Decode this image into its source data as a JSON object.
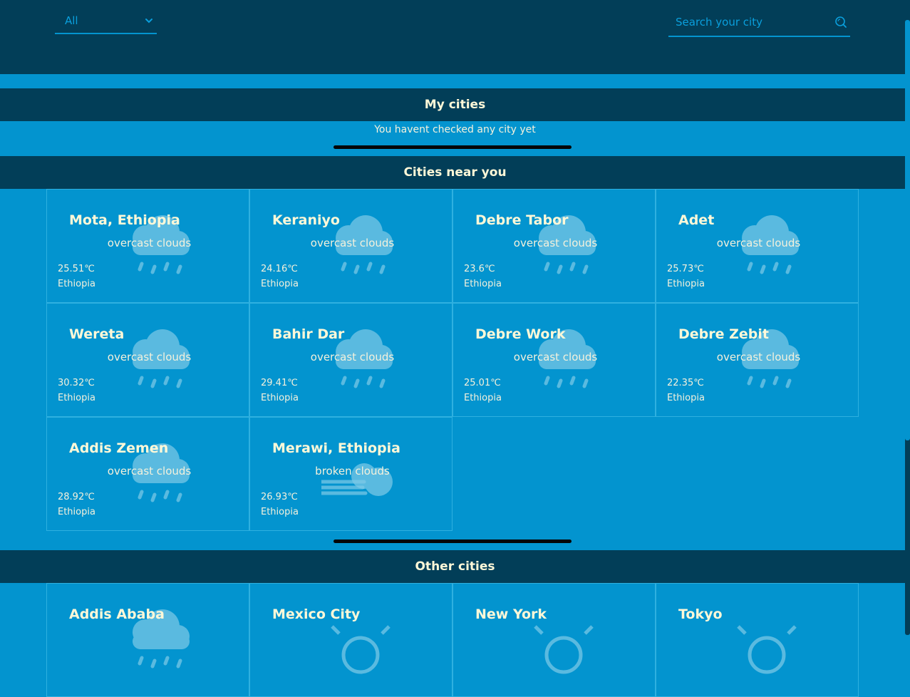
{
  "filter": {
    "value": "All"
  },
  "search": {
    "placeholder": "Search your city"
  },
  "my_cities": {
    "title": "My cities",
    "empty_message": "You havent checked any city yet"
  },
  "near": {
    "title": "Cities near you",
    "cities": [
      {
        "name": "Mota, Ethiopia",
        "desc": "overcast clouds",
        "temp": "25.51℃",
        "country": "Ethiopia",
        "icon": "rain-cloud-icon"
      },
      {
        "name": "Keraniyo",
        "desc": "overcast clouds",
        "temp": "24.16℃",
        "country": "Ethiopia",
        "icon": "rain-cloud-icon"
      },
      {
        "name": "Debre Tabor",
        "desc": "overcast clouds",
        "temp": "23.6℃",
        "country": "Ethiopia",
        "icon": "rain-cloud-icon"
      },
      {
        "name": "Adet",
        "desc": "overcast clouds",
        "temp": "25.73℃",
        "country": "Ethiopia",
        "icon": "rain-cloud-icon"
      },
      {
        "name": "Wereta",
        "desc": "overcast clouds",
        "temp": "30.32℃",
        "country": "Ethiopia",
        "icon": "rain-cloud-icon"
      },
      {
        "name": "Bahir Dar",
        "desc": "overcast clouds",
        "temp": "29.41℃",
        "country": "Ethiopia",
        "icon": "rain-cloud-icon"
      },
      {
        "name": "Debre Work",
        "desc": "overcast clouds",
        "temp": "25.01℃",
        "country": "Ethiopia",
        "icon": "rain-cloud-icon"
      },
      {
        "name": "Debre Zebit",
        "desc": "overcast clouds",
        "temp": "22.35℃",
        "country": "Ethiopia",
        "icon": "rain-cloud-icon"
      },
      {
        "name": "Addis Zemen",
        "desc": "overcast clouds",
        "temp": "28.92℃",
        "country": "Ethiopia",
        "icon": "rain-cloud-icon"
      },
      {
        "name": "Merawi, Ethiopia",
        "desc": "broken clouds",
        "temp": "26.93℃",
        "country": "Ethiopia",
        "icon": "wind-cloud-icon"
      }
    ]
  },
  "other": {
    "title": "Other cities",
    "cities": [
      {
        "name": "Addis Ababa",
        "icon": "rain-cloud-icon"
      },
      {
        "name": "Mexico City",
        "icon": "sun-cloud-icon"
      },
      {
        "name": "New York",
        "icon": "sun-cloud-icon"
      },
      {
        "name": "Tokyo",
        "icon": "sun-cloud-icon"
      }
    ]
  },
  "colors": {
    "dark": "#023e58",
    "main": "#0394cf",
    "text": "#fff8d8"
  }
}
